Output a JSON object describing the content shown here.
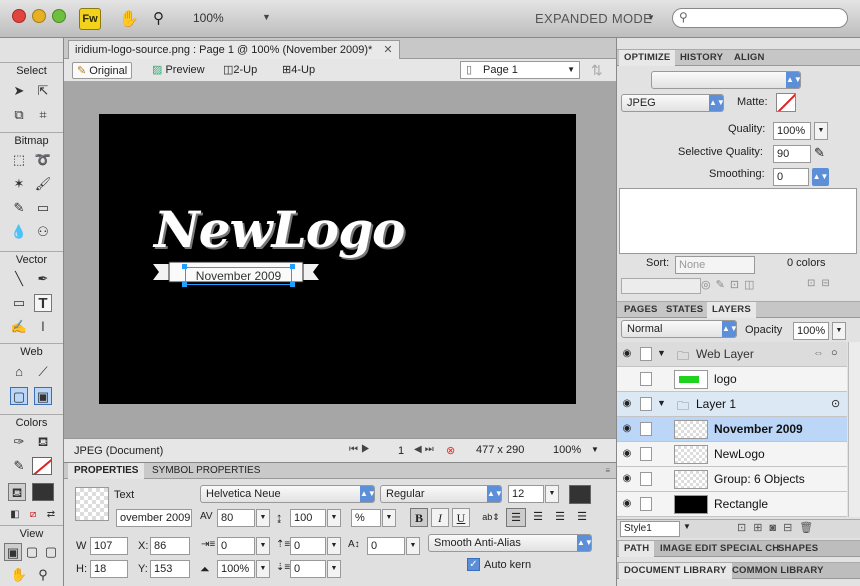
{
  "app": {
    "logo": "Fw",
    "zoom": "100%",
    "workspace_mode": "EXPANDED MODE",
    "search_placeholder": ""
  },
  "document": {
    "tab_title": "iridium-logo-source.png : Page 1 @ 100% (November 2009)*",
    "view_tabs": [
      "Original",
      "Preview",
      "2-Up",
      "4-Up"
    ],
    "page_selector": "Page 1"
  },
  "canvas": {
    "logo_text": "NewLogo",
    "banner_text": "November 2009"
  },
  "status": {
    "format": "JPEG (Document)",
    "page_number": "1",
    "dimensions": "477 x 290",
    "zoom": "100%"
  },
  "tools": {
    "sections": [
      "Select",
      "Bitmap",
      "Vector",
      "Web",
      "Colors",
      "View"
    ]
  },
  "properties": {
    "tabs": [
      "PROPERTIES",
      "SYMBOL PROPERTIES"
    ],
    "object_type": "Text",
    "object_name": "ovember 2009",
    "font_family": "Helvetica Neue",
    "font_style": "Regular",
    "font_size": "12",
    "kerning": "80",
    "leading": "100",
    "leading_unit": "%",
    "bold": "B",
    "italic": "I",
    "underline": "U",
    "w": "107",
    "x": "86",
    "h": "18",
    "y": "153",
    "indent": "0",
    "space_before": "0",
    "baseline_shift": "0",
    "horizontal_scale": "100%",
    "space_after": "0",
    "anti_alias": "Smooth Anti-Alias",
    "auto_kern": "Auto kern",
    "labels": {
      "w": "W",
      "x": "X:",
      "h": "H:",
      "y": "Y:"
    }
  },
  "optimize": {
    "tabs": [
      "OPTIMIZE",
      "HISTORY",
      "ALIGN"
    ],
    "format": "JPEG",
    "matte_label": "Matte:",
    "quality_label": "Quality:",
    "quality": "100%",
    "selective_quality_label": "Selective Quality:",
    "selective_quality": "90",
    "smoothing_label": "Smoothing:",
    "smoothing": "0",
    "sort_label": "Sort:",
    "sort_value": "None",
    "colors_count": "0 colors"
  },
  "layers_panel": {
    "tabs": [
      "PAGES",
      "STATES",
      "LAYERS"
    ],
    "blend_mode": "Normal",
    "opacity_label": "Opacity",
    "opacity": "100%",
    "layers": [
      {
        "name": "Web Layer",
        "type": "folder"
      },
      {
        "name": "logo",
        "type": "object"
      },
      {
        "name": "Layer 1",
        "type": "folder"
      },
      {
        "name": "November 2009",
        "type": "object"
      },
      {
        "name": "NewLogo",
        "type": "object"
      },
      {
        "name": "Group: 6 Objects",
        "type": "object"
      },
      {
        "name": "Rectangle",
        "type": "object"
      }
    ],
    "style_selector": "Style1"
  },
  "bottom_tabs": [
    "PATH",
    "IMAGE EDIT",
    "SPECIAL CH",
    "SHAPES"
  ],
  "library_tabs": [
    "DOCUMENT LIBRARY",
    "COMMON LIBRARY"
  ],
  "colors": {
    "selection_blue": "#1ea0ff",
    "layer_highlight": "#bcd6f7",
    "green_thumb": "#21d321"
  }
}
